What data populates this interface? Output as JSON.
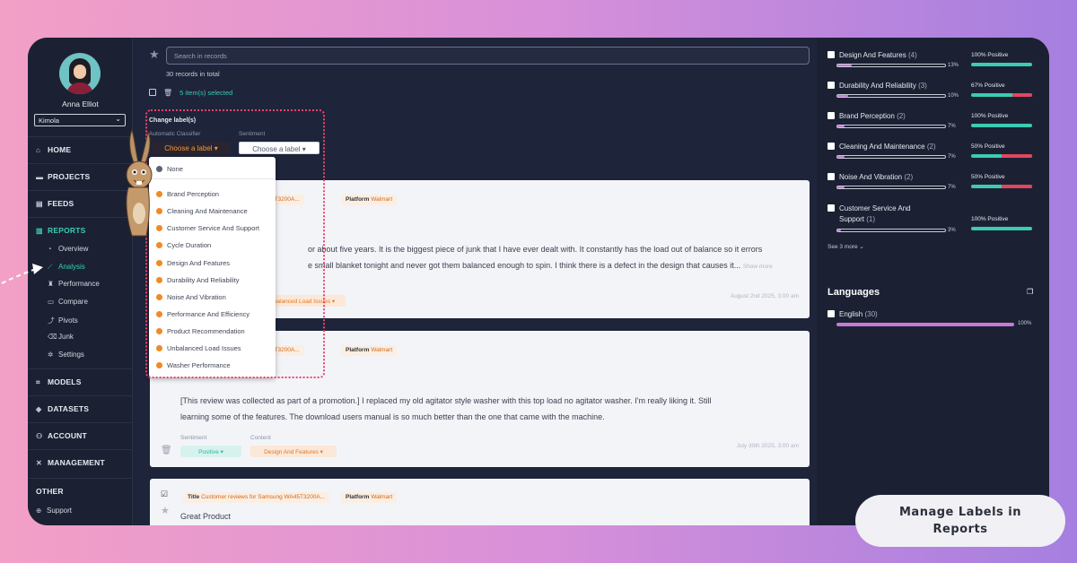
{
  "user": {
    "name": "Anna Elliot",
    "org": "Kimola"
  },
  "nav": {
    "home": "HOME",
    "projects": "PROJECTS",
    "feeds": "FEEDS",
    "reports": "REPORTS",
    "sub": [
      "Overview",
      "Analysis",
      "Performance",
      "Compare",
      "Pivots",
      "Junk",
      "Settings"
    ],
    "models": "MODELS",
    "datasets": "DATASETS",
    "account": "ACCOUNT",
    "management": "MANAGEMENT",
    "other": "OTHER",
    "support": "Support"
  },
  "search": {
    "placeholder": "Search in records"
  },
  "records": "30 records in total",
  "selected": "5 item(s) selected",
  "change": {
    "title": "Change label(s)",
    "classifier": "Automatic Classifier",
    "sentiment": "Sentiment",
    "choose": "Choose a label ▾"
  },
  "menu": [
    "None",
    "Brand Perception",
    "Cleaning And Maintenance",
    "Customer Service And Support",
    "Cycle Duration",
    "Design And Features",
    "Durability And Reliability",
    "Noise And Vibration",
    "Performance And Efficiency",
    "Product Recommendation",
    "Unbalanced Load Issues",
    "Washer Performance"
  ],
  "card1": {
    "title_tail": "ng WA45T3200A...",
    "platform_label": "Platform",
    "platform": "Walmart",
    "text1": "or about five years. It is the biggest piece of junk that I have ever dealt with. It constantly has the load out of balance so it errors",
    "text2": "e small blanket tonight and never got them balanced enough to spin. I think there is a defect in the design that causes it...",
    "more": "Show more",
    "chip": "balanced Load Issues ▾",
    "date": "August 2nd 2025, 3:00 am"
  },
  "card2": {
    "title_tail": "ng WA45T3200A...",
    "platform_label": "Platform",
    "platform": "Walmart",
    "text1": "[This review was collected as part of a promotion.] I replaced my old agitator style washer with this top load no agitator washer. I'm really liking it. Still",
    "text2": "learning some of the features. The download users manual is so much better than the one that came with the machine.",
    "sent_label": "Sentiment",
    "content_label": "Content",
    "sent": "Positive ▾",
    "content": "Design And Features ▾",
    "date": "July 30th 2025, 3:00 am"
  },
  "card3": {
    "title_label": "Title",
    "title": "Customer reviews for Samsung WA45T3200A...",
    "platform_label": "Platform",
    "platform": "Walmart",
    "headline": "Great Product"
  },
  "filters": [
    {
      "name": "Design And Features",
      "count": "(4)",
      "pct": "13%",
      "sent": "100% Positive",
      "fill": 0.13,
      "neg": 0
    },
    {
      "name": "Durability And Reliability",
      "count": "(3)",
      "pct": "10%",
      "sent": "67% Positive",
      "fill": 0.1,
      "neg": 0.33
    },
    {
      "name": "Brand Perception",
      "count": "(2)",
      "pct": "7%",
      "sent": "100% Positive",
      "fill": 0.07,
      "neg": 0
    },
    {
      "name": "Cleaning And Maintenance",
      "count": "(2)",
      "pct": "7%",
      "sent": "50% Positive",
      "fill": 0.07,
      "neg": 0.5
    },
    {
      "name": "Noise And Vibration",
      "count": "(2)",
      "pct": "7%",
      "sent": "50% Positive",
      "fill": 0.07,
      "neg": 0.5
    }
  ],
  "filter6": {
    "name1": "Customer Service And",
    "name2": "Support",
    "count": "(1)",
    "pct": "3%",
    "sent": "100% Positive"
  },
  "see_more": "See 3 more ⌄",
  "languages": {
    "title": "Languages",
    "item": "English",
    "count": "(30)",
    "pct": "100%"
  },
  "callout": {
    "line1": "Manage Labels in",
    "line2": "Reports"
  },
  "colors": {
    "accent": "#3ccbb4",
    "orange": "#f08a24",
    "negative": "#e0475e",
    "bar": "#c57ad6"
  }
}
